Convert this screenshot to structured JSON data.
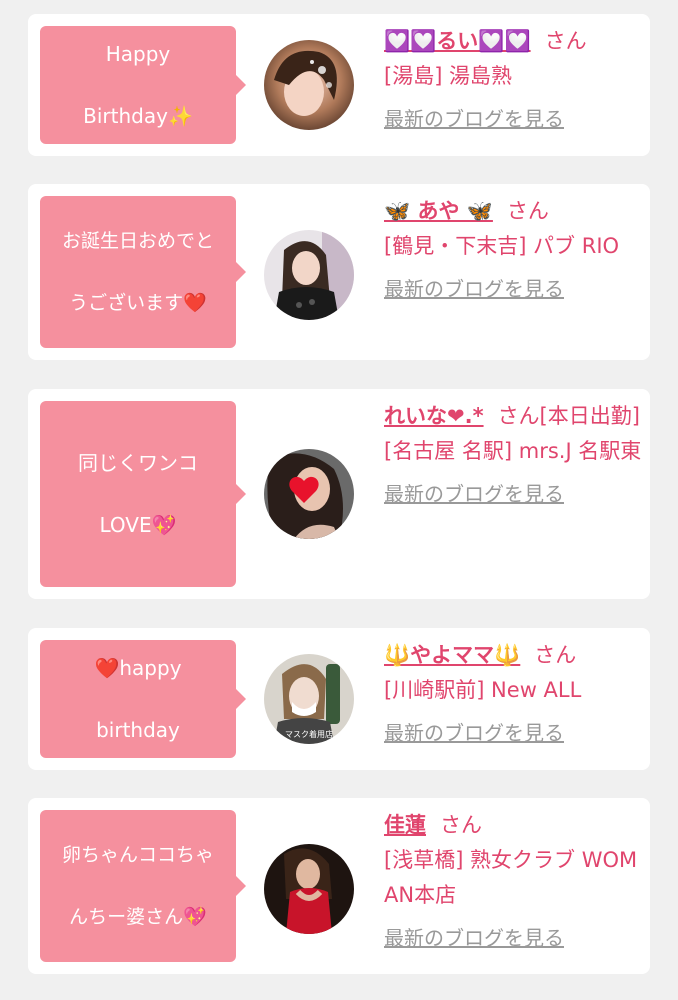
{
  "entries": [
    {
      "message_line1": "Happy",
      "message_line2": "Birthday✨",
      "name": "💟💟るい💟💟",
      "suffix": "さん",
      "shop": "[湯島] 湯島熟",
      "blog_link": "最新のブログを見る"
    },
    {
      "message_line1": "お誕生日おめでと",
      "message_line2": "うございます❤️",
      "name": "🦋 あや 🦋",
      "suffix": "さん",
      "shop": "[鶴見・下末吉] パブ RIO",
      "blog_link": "最新のブログを見る"
    },
    {
      "message_line1": "同じくワンコ",
      "message_line2": "LOVE💖",
      "name": "れいな❤︎.*",
      "suffix": "さん[本日出勤]",
      "shop": "[名古屋 名駅] mrs.J 名駅東",
      "blog_link": "最新のブログを見る"
    },
    {
      "message_line1": "❤️happy",
      "message_line2": "birthday",
      "name": "🔱やよママ🔱",
      "suffix": "さん",
      "shop": "[川崎駅前] New ALL",
      "blog_link": "最新のブログを見る",
      "avatar_caption": "マスク着用店"
    },
    {
      "message_line1": "卵ちゃんココちゃ",
      "message_line2": "んちー婆さん💖",
      "name": "佳蓮",
      "suffix": "さん",
      "shop": "[浅草橋] 熟女クラブ WOMAN本店",
      "blog_link": "最新のブログを見る"
    }
  ],
  "colors": {
    "background": "#f0f0f0",
    "bubble": "#f5909e",
    "accent": "#e0456d",
    "link": "#999999"
  }
}
